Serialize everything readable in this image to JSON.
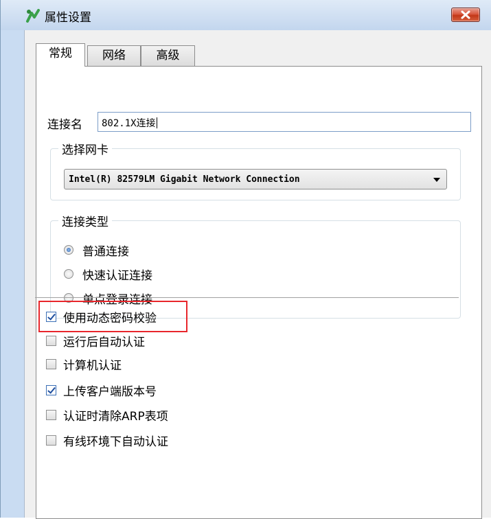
{
  "window": {
    "title": "属性设置",
    "icon": "app-logo-icon",
    "close_icon": "close-icon",
    "accent": "#d9583f"
  },
  "tabs": [
    {
      "label": "常规",
      "active": true
    },
    {
      "label": "网络",
      "active": false
    },
    {
      "label": "高级",
      "active": false
    }
  ],
  "general": {
    "connection_name_label": "连接名",
    "connection_name_value": "802.1X连接",
    "nic_group_label": "选择网卡",
    "nic_selected": "Intel(R) 82579LM Gigabit Network Connection",
    "connection_type_label": "连接类型",
    "connection_types": [
      {
        "label": "普通连接",
        "selected": true
      },
      {
        "label": "快速认证连接",
        "selected": false
      },
      {
        "label": "单点登录连接",
        "selected": false
      }
    ],
    "options": [
      {
        "label": "使用动态密码校验",
        "checked": true,
        "highlighted": true
      },
      {
        "label": "运行后自动认证",
        "checked": false
      },
      {
        "label": "计算机认证",
        "checked": false
      },
      {
        "label": "上传客户端版本号",
        "checked": true
      },
      {
        "label": "认证时清除ARP表项",
        "checked": false
      },
      {
        "label": "有线环境下自动认证",
        "checked": false
      }
    ]
  },
  "colors": {
    "highlight_box": "#e8262b",
    "checkmark": "#1f4f9f"
  }
}
